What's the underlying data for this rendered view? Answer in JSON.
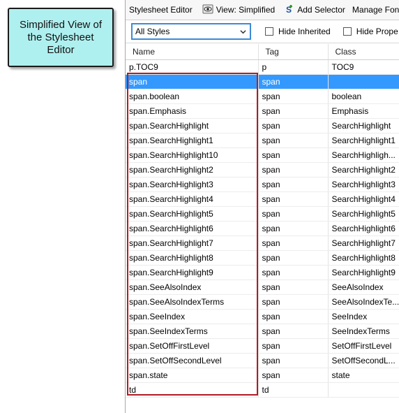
{
  "callout": {
    "text": "Simplified View of the Stylesheet Editor"
  },
  "toolbar": {
    "title": "Stylesheet Editor",
    "view_label": "View: Simplified",
    "add_selector_label": "Add Selector",
    "manage_fonts_label": "Manage Fon"
  },
  "filter": {
    "select_value": "All Styles",
    "hide_inherited_label": "Hide Inherited",
    "hide_properties_label": "Hide Prope"
  },
  "table": {
    "headers": {
      "name": "Name",
      "tag": "Tag",
      "class": "Class"
    },
    "rows": [
      {
        "name": "p.TOC9",
        "tag": "p",
        "class": "TOC9"
      },
      {
        "name": "span",
        "tag": "span",
        "class": ""
      },
      {
        "name": "span.boolean",
        "tag": "span",
        "class": "boolean"
      },
      {
        "name": "span.Emphasis",
        "tag": "span",
        "class": "Emphasis"
      },
      {
        "name": "span.SearchHighlight",
        "tag": "span",
        "class": "SearchHighlight"
      },
      {
        "name": "span.SearchHighlight1",
        "tag": "span",
        "class": "SearchHighlight1"
      },
      {
        "name": "span.SearchHighlight10",
        "tag": "span",
        "class": "SearchHighligh..."
      },
      {
        "name": "span.SearchHighlight2",
        "tag": "span",
        "class": "SearchHighlight2"
      },
      {
        "name": "span.SearchHighlight3",
        "tag": "span",
        "class": "SearchHighlight3"
      },
      {
        "name": "span.SearchHighlight4",
        "tag": "span",
        "class": "SearchHighlight4"
      },
      {
        "name": "span.SearchHighlight5",
        "tag": "span",
        "class": "SearchHighlight5"
      },
      {
        "name": "span.SearchHighlight6",
        "tag": "span",
        "class": "SearchHighlight6"
      },
      {
        "name": "span.SearchHighlight7",
        "tag": "span",
        "class": "SearchHighlight7"
      },
      {
        "name": "span.SearchHighlight8",
        "tag": "span",
        "class": "SearchHighlight8"
      },
      {
        "name": "span.SearchHighlight9",
        "tag": "span",
        "class": "SearchHighlight9"
      },
      {
        "name": "span.SeeAlsoIndex",
        "tag": "span",
        "class": "SeeAlsoIndex"
      },
      {
        "name": "span.SeeAlsoIndexTerms",
        "tag": "span",
        "class": "SeeAlsoIndexTe..."
      },
      {
        "name": "span.SeeIndex",
        "tag": "span",
        "class": "SeeIndex"
      },
      {
        "name": "span.SeeIndexTerms",
        "tag": "span",
        "class": "SeeIndexTerms"
      },
      {
        "name": "span.SetOffFirstLevel",
        "tag": "span",
        "class": "SetOffFirstLevel"
      },
      {
        "name": "span.SetOffSecondLevel",
        "tag": "span",
        "class": "SetOffSecondL..."
      },
      {
        "name": "span.state",
        "tag": "span",
        "class": "state"
      },
      {
        "name": "td",
        "tag": "td",
        "class": ""
      }
    ],
    "selected_index": 1
  },
  "icons": {
    "view": "view-eye-icon",
    "add_selector": "add-selector-icon",
    "dropdown": "chevron-down-icon"
  },
  "colors": {
    "selection": "#3399ff",
    "callout_bg": "#aef0ef",
    "highlight_border": "#b01c24",
    "select_border": "#3d8ad6"
  }
}
